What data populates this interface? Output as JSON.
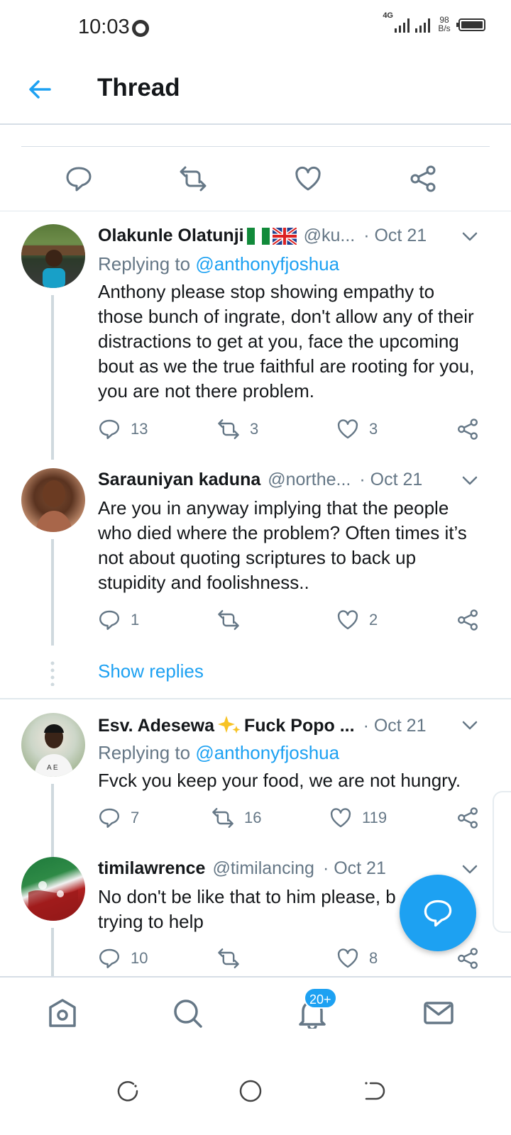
{
  "status": {
    "time": "10:03",
    "network": "4G",
    "speed_value": "98",
    "speed_unit": "B/s"
  },
  "header": {
    "title": "Thread"
  },
  "tweets": [
    {
      "name": "Olakunle Olatunji",
      "flags": [
        "nigeria-flag",
        "uk-flag"
      ],
      "handle": "@ku...",
      "date": "· Oct 21",
      "reply_prefix": "Replying to ",
      "reply_to": "@anthonyfjoshua",
      "text": "Anthony please stop showing empathy to those bunch of ingrate, don't allow any of their distractions to get at you, face the upcoming bout as we the true faithful are rooting for you, you are not there problem.",
      "replies": "13",
      "retweets": "3",
      "likes": "3"
    },
    {
      "name": "Sarauniyan kaduna",
      "handle": "@northe...",
      "date": "· Oct 21",
      "text": "Are you in anyway implying that the people who died where the problem? Often times it’s not about quoting scriptures to back up stupidity and foolishness..",
      "replies": "1",
      "retweets": "",
      "likes": "2"
    },
    {
      "name": "Esv. Adesewa",
      "name_suffix": "Fuck Popo ...",
      "emoji": "sparkles-icon",
      "handle": "",
      "date": "· Oct 21",
      "reply_prefix": "Replying to ",
      "reply_to": "@anthonyfjoshua",
      "text": "Fvck you keep your food, we are not hungry.",
      "replies": "7",
      "retweets": "16",
      "likes": "119"
    },
    {
      "name": "timilawrence",
      "handle": "@timilancing",
      "date": "· Oct 21",
      "text": "No don't be like that to him please, b trying to help",
      "replies": "10",
      "retweets": "",
      "likes": "8"
    }
  ],
  "show_replies": "Show replies",
  "nav": {
    "notifications_badge": "20+"
  },
  "colors": {
    "accent": "#1da1f2",
    "muted": "#657786",
    "divider": "#e1e8ed"
  }
}
